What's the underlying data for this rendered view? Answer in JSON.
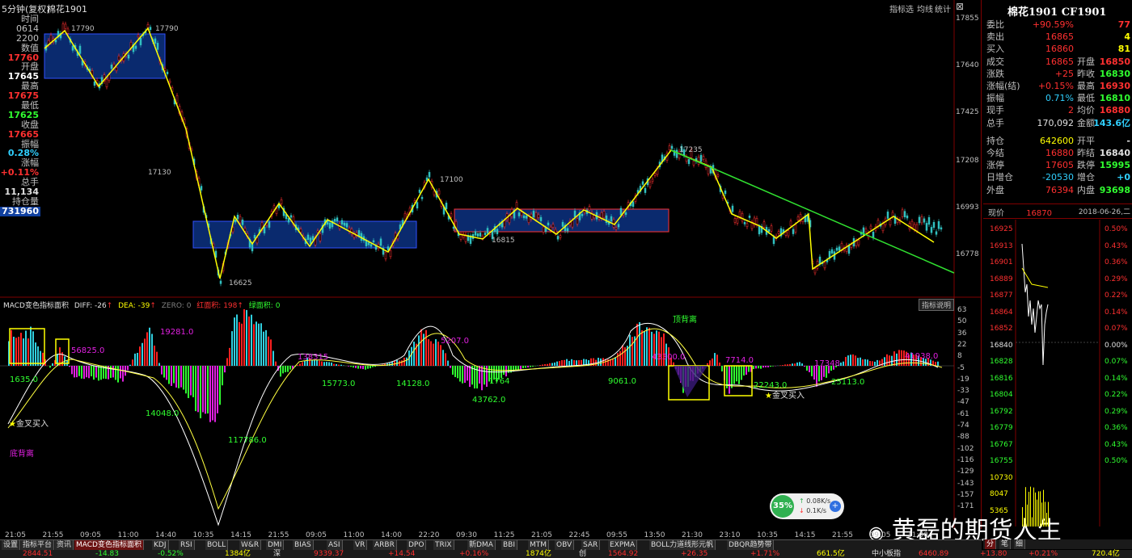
{
  "window": {
    "title_prefix": "5分钟(复权)",
    "symbol": "棉花1901",
    "top_buttons": [
      "指标选",
      "均线",
      "统计"
    ]
  },
  "left_info": [
    {
      "label": "时间",
      "value": ""
    },
    {
      "label": "0614",
      "value": ""
    },
    {
      "label": "2200",
      "value": ""
    },
    {
      "label": "数值",
      "value": ""
    },
    {
      "label": "17760",
      "value": "",
      "color": "#ff3030"
    },
    {
      "label": "开盘",
      "value": ""
    },
    {
      "label": "17645",
      "value": "",
      "color": "#ffffff"
    },
    {
      "label": "最高",
      "value": ""
    },
    {
      "label": "17675",
      "value": "",
      "color": "#ff3030"
    },
    {
      "label": "最低",
      "value": ""
    },
    {
      "label": "17625",
      "value": "",
      "color": "#30ff30"
    },
    {
      "label": "收盘",
      "value": ""
    },
    {
      "label": "17665",
      "value": "",
      "color": "#ff3030"
    },
    {
      "label": "振幅",
      "value": ""
    },
    {
      "label": "0.28%",
      "value": "",
      "color": "#30d0ff"
    },
    {
      "label": "涨幅",
      "value": ""
    },
    {
      "label": "+0.11%",
      "value": "",
      "color": "#ff3030"
    },
    {
      "label": "总手",
      "value": ""
    },
    {
      "label": "11,134",
      "value": "",
      "color": "#e0e0e0"
    },
    {
      "label": "持仓量",
      "value": ""
    },
    {
      "label": "731960",
      "value": "",
      "color": "#ffffff"
    }
  ],
  "price_axis": [
    "17855",
    "17640",
    "17425",
    "17208",
    "16993",
    "16778"
  ],
  "price_annotations": [
    {
      "text": "17790"
    },
    {
      "text": "17790"
    },
    {
      "text": "17130"
    },
    {
      "text": "17100"
    },
    {
      "text": "17235"
    },
    {
      "text": "16815"
    },
    {
      "text": "16625"
    }
  ],
  "macd_header": {
    "name": "MACD变色指标面积",
    "diff": "DIFF: -26",
    "dea": "DEA: -39",
    "zero": "ZERO: 0",
    "red_area": "红面积: 198",
    "green_area": "绿面积: 0",
    "help_btn": "指标说明"
  },
  "macd_axis": [
    "63",
    "50",
    "36",
    "22",
    "8",
    "-5",
    "-19",
    "-33",
    "-47",
    "-61",
    "-74",
    "-88",
    "-102",
    "-116",
    "-129",
    "-143",
    "-157",
    "-171"
  ],
  "macd_labels": [
    {
      "text": "19281.0",
      "color": "#e020e0"
    },
    {
      "text": "56825.0",
      "color": "#e020e0"
    },
    {
      "text": "1635.0",
      "color": "#30ff30"
    },
    {
      "text": "14048.0",
      "color": "#30ff30"
    },
    {
      "text": "117786.0",
      "color": "#30ff30"
    },
    {
      "text": "138315",
      "color": "#e020e0"
    },
    {
      "text": "15773.0",
      "color": "#30ff30"
    },
    {
      "text": "14128.0",
      "color": "#30ff30"
    },
    {
      "text": "5207.0",
      "color": "#e020e0"
    },
    {
      "text": "43762.0",
      "color": "#30ff30"
    },
    {
      "text": "1764",
      "color": "#30ff30"
    },
    {
      "text": "9061.0",
      "color": "#30ff30"
    },
    {
      "text": "43300.0",
      "color": "#e020e0"
    },
    {
      "text": "7714.0",
      "color": "#e020e0"
    },
    {
      "text": "22243.0",
      "color": "#30ff30"
    },
    {
      "text": "17348",
      "color": "#e020e0"
    },
    {
      "text": "25113.0",
      "color": "#30ff30"
    },
    {
      "text": "41938.0",
      "color": "#e020e0"
    }
  ],
  "annotations": {
    "golden_cross_1": "金叉买入",
    "golden_cross_2": "金叉买入",
    "bottom_divergence": "底背离",
    "top_divergence": "顶背离"
  },
  "time_axis": [
    "21:05",
    "21:55",
    "09:05",
    "11:00",
    "14:40",
    "10:35",
    "14:15",
    "21:55",
    "09:05",
    "11:00",
    "14:00",
    "22:20",
    "09:30",
    "11:25",
    "21:05",
    "22:45",
    "09:55",
    "13:50",
    "21:30",
    "23:10",
    "10:35",
    "14:15",
    "21:55",
    "09:05",
    "11:00"
  ],
  "tabs": [
    "设置",
    "指标平台",
    "资讯",
    "MACD变色指标面积",
    "KDJ",
    "RSI",
    "BOLL",
    "W&R",
    "DMI",
    "BIAS",
    "ASI",
    "VR",
    "ARBR",
    "DPO",
    "TRIX",
    "新DMA",
    "BBI",
    "MTM",
    "OBV",
    "SAR",
    "EXPMA",
    "BOLL力道线形元帆",
    "DBQR趋势带"
  ],
  "speed_widget": {
    "percent": "35%",
    "up": "0.08K/s",
    "down": "0.1K/s"
  },
  "quote": {
    "title": "棉花1901 CF1901",
    "rows": [
      {
        "l1": "委比",
        "v1": "+90.59%",
        "c1": "#ff3030",
        "l2": "",
        "v2": "77",
        "c2": "#ff3030"
      },
      {
        "l1": "卖出",
        "v1": "16865",
        "c1": "#ff3030",
        "l2": "",
        "v2": "4",
        "c2": "#ffff00"
      },
      {
        "l1": "买入",
        "v1": "16860",
        "c1": "#ff3030",
        "l2": "",
        "v2": "81",
        "c2": "#ffff00"
      },
      {
        "l1": "成交",
        "v1": "16865",
        "c1": "#ff3030",
        "l2": "开盘",
        "v2": "16850",
        "c2": "#ff3030"
      },
      {
        "l1": "涨跌",
        "v1": "+25",
        "c1": "#ff3030",
        "l2": "昨收",
        "v2": "16830",
        "c2": "#30ff30"
      },
      {
        "l1": "涨幅(结)",
        "v1": "+0.15%",
        "c1": "#ff3030",
        "l2": "最高",
        "v2": "16930",
        "c2": "#ff3030"
      },
      {
        "l1": "振幅",
        "v1": "0.71%",
        "c1": "#30d0ff",
        "l2": "最低",
        "v2": "16810",
        "c2": "#30ff30"
      },
      {
        "l1": "现手",
        "v1": "2",
        "c1": "#ff3030",
        "l2": "均价",
        "v2": "16880",
        "c2": "#ff3030"
      },
      {
        "l1": "总手",
        "v1": "170,092",
        "c1": "#e0e0e0",
        "l2": "金额",
        "v2": "143.6亿",
        "c2": "#30d0ff"
      },
      {
        "l1": "持仓",
        "v1": "642600",
        "c1": "#ffff00",
        "l2": "开平",
        "v2": "-",
        "c2": "#e0e0e0"
      },
      {
        "l1": "今结",
        "v1": "16880",
        "c1": "#ff3030",
        "l2": "昨结",
        "v2": "16840",
        "c2": "#e0e0e0"
      },
      {
        "l1": "涨停",
        "v1": "17605",
        "c1": "#ff3030",
        "l2": "跌停",
        "v2": "15995",
        "c2": "#30ff30"
      },
      {
        "l1": "日增仓",
        "v1": "-20530",
        "c1": "#30d0ff",
        "l2": "增仓",
        "v2": "+0",
        "c2": "#30d0ff"
      },
      {
        "l1": "外盘",
        "v1": "76394",
        "c1": "#ff3030",
        "l2": "内盘",
        "v2": "93698",
        "c2": "#30ff30"
      }
    ],
    "price_line": {
      "label": "现价",
      "value": "16870",
      "date": "2018-06-26,二"
    },
    "mini_axis_left": [
      "16925",
      "16913",
      "16901",
      "16889",
      "16877",
      "16864",
      "16852",
      "16840",
      "16828",
      "16816",
      "16804",
      "16792",
      "16779",
      "16767",
      "16755",
      "10730",
      "8047",
      "5365"
    ],
    "mini_axis_right": [
      "0.50%",
      "0.43%",
      "0.36%",
      "0.29%",
      "0.22%",
      "0.14%",
      "0.07%",
      "0.00%",
      "0.07%",
      "0.14%",
      "0.22%",
      "0.29%",
      "0.36%",
      "0.43%",
      "0.50%"
    ],
    "mini_tabs": [
      "分",
      "笔",
      "细"
    ]
  },
  "status": [
    {
      "text": "2844.51",
      "color": "#ff3030"
    },
    {
      "text": "-14.83",
      "color": "#30ff30"
    },
    {
      "text": "-0.52%",
      "color": "#30ff30"
    },
    {
      "text": "1384亿",
      "color": "#ffff00"
    },
    {
      "text": "深",
      "color": "#e0e0e0"
    },
    {
      "text": "9339.37",
      "color": "#ff3030"
    },
    {
      "text": "+14.54",
      "color": "#ff3030"
    },
    {
      "text": "+0.16%",
      "color": "#ff3030"
    },
    {
      "text": "1874亿",
      "color": "#ffff00"
    },
    {
      "text": "创",
      "color": "#e0e0e0"
    },
    {
      "text": "1564.92",
      "color": "#ff3030"
    },
    {
      "text": "+26.35",
      "color": "#ff3030"
    },
    {
      "text": "+1.71%",
      "color": "#ff3030"
    },
    {
      "text": "661.5亿",
      "color": "#ffff00"
    },
    {
      "text": "中小板指",
      "color": "#e0e0e0"
    },
    {
      "text": "6460.89",
      "color": "#ff3030"
    },
    {
      "text": "+13.80",
      "color": "#ff3030"
    },
    {
      "text": "+0.21%",
      "color": "#ff3030"
    },
    {
      "text": "720.4亿",
      "color": "#ffff00"
    }
  ],
  "watermark": "黄磊的期货人生",
  "colors": {
    "up": "#ff3030",
    "down": "#30ff30",
    "zigzag": "#ffff00",
    "trend": "#30e030",
    "box": "#0a2a6e"
  }
}
